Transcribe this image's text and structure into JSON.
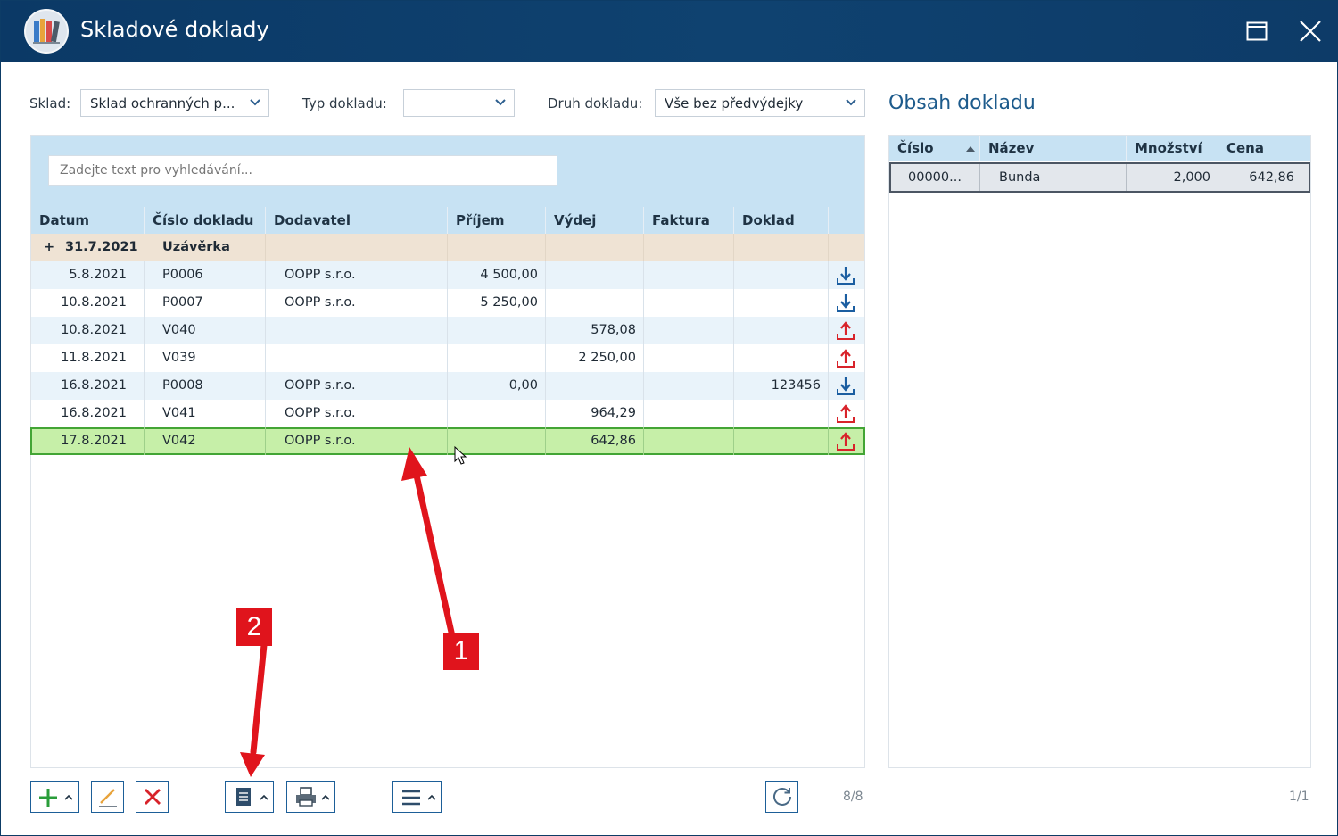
{
  "window": {
    "title": "Skladové doklady"
  },
  "filters": {
    "sklad_label": "Sklad:",
    "sklad_value": "Sklad ochranných p...",
    "typ_label": "Typ dokladu:",
    "typ_value": "",
    "druh_label": "Druh dokladu:",
    "druh_value": "Vše bez předvýdejky"
  },
  "search": {
    "placeholder": "Zadejte text pro vyhledávání..."
  },
  "grid": {
    "columns": [
      "Datum",
      "Číslo dokladu",
      "Dodavatel",
      "Příjem",
      "Výdej",
      "Faktura",
      "Doklad"
    ],
    "group": {
      "expander": "+",
      "date": "31.7.2021",
      "label": "Uzávěrka"
    },
    "rows": [
      {
        "datum": "5.8.2021",
        "cislo": "P0006",
        "dodavatel": "OOPP s.r.o.",
        "prijem": "4 500,00",
        "vydej": "",
        "faktura": "",
        "type": "prijem"
      },
      {
        "datum": "10.8.2021",
        "cislo": "P0007",
        "dodavatel": "OOPP s.r.o.",
        "prijem": "5 250,00",
        "vydej": "",
        "faktura": "",
        "type": "prijem"
      },
      {
        "datum": "10.8.2021",
        "cislo": "V040",
        "dodavatel": "",
        "prijem": "",
        "vydej": "578,08",
        "faktura": "",
        "type": "vydej"
      },
      {
        "datum": "11.8.2021",
        "cislo": "V039",
        "dodavatel": "",
        "prijem": "",
        "vydej": "2 250,00",
        "faktura": "",
        "type": "vydej"
      },
      {
        "datum": "16.8.2021",
        "cislo": "P0008",
        "dodavatel": "OOPP s.r.o.",
        "prijem": "0,00",
        "vydej": "",
        "faktura": "123456",
        "type": "prijem"
      },
      {
        "datum": "16.8.2021",
        "cislo": "V041",
        "dodavatel": "OOPP s.r.o.",
        "prijem": "",
        "vydej": "964,29",
        "faktura": "",
        "type": "vydej"
      },
      {
        "datum": "17.8.2021",
        "cislo": "V042",
        "dodavatel": "OOPP s.r.o.",
        "prijem": "",
        "vydej": "642,86",
        "faktura": "",
        "type": "vydej",
        "selected": true
      }
    ],
    "counter": "8/8"
  },
  "obsah": {
    "title": "Obsah dokladu",
    "columns": [
      "Číslo",
      "Název",
      "Množství",
      "Cena"
    ],
    "rows": [
      {
        "cislo": "00000...",
        "nazev": "Bunda",
        "mnozstvi": "2,000",
        "cena": "642,86"
      }
    ],
    "counter": "1/1"
  },
  "annotations": {
    "badge1": "1",
    "badge2": "2"
  },
  "icons": {
    "prijem": "download-icon",
    "vydej": "upload-icon"
  },
  "colors": {
    "titlebar": "#0b3966",
    "accent": "#1d5f98",
    "selected_row": "#c6efa8",
    "prijem_icon": "#1b5ea1",
    "vydej_icon": "#d8232a",
    "annotation": "#e0141c"
  }
}
